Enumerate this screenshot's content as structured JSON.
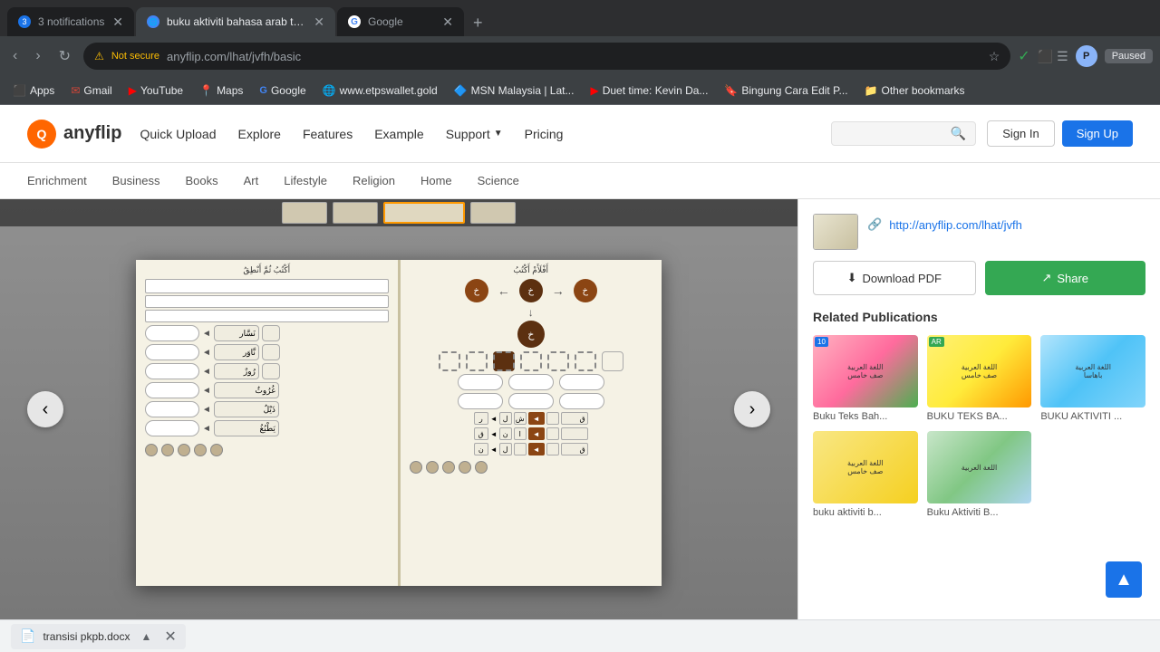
{
  "browser": {
    "tabs": [
      {
        "id": "t1",
        "label": "3 notifications",
        "favicon_type": "notification",
        "active": false
      },
      {
        "id": "t2",
        "label": "buku aktiviti bahasa arab tahun ...",
        "favicon_type": "globe",
        "active": true
      },
      {
        "id": "t3",
        "label": "Google",
        "favicon_type": "google",
        "active": false
      }
    ],
    "address": "anyflip.com/lhat/jvfh/basic",
    "security": "Not secure",
    "profile": "P",
    "paused_label": "Paused"
  },
  "bookmarks": [
    {
      "label": "Apps"
    },
    {
      "label": "Gmail"
    },
    {
      "label": "YouTube"
    },
    {
      "label": "Maps"
    },
    {
      "label": "Google"
    },
    {
      "label": "www.etpswallet.gold"
    },
    {
      "label": "MSN Malaysia | Lat..."
    },
    {
      "label": "Duet time: Kevin Da..."
    },
    {
      "label": "Bingung Cara Edit P..."
    },
    {
      "label": "Other bookmarks"
    }
  ],
  "header": {
    "logo_initial": "Q",
    "logo_name": "anyflip",
    "quick_upload": "Quick Upload",
    "explore": "Explore",
    "features": "Features",
    "example": "Example",
    "support": "Support",
    "pricing": "Pricing",
    "search_placeholder": "",
    "signin": "Sign In",
    "signup": "Sign Up"
  },
  "categories": [
    "Enrichment",
    "Business",
    "Books",
    "Art",
    "Lifestyle",
    "Religion",
    "Home",
    "Science"
  ],
  "sidebar": {
    "pub_url": "http://anyflip.com/lhat/jvfh",
    "download_label": "Download PDF",
    "share_label": "Share",
    "related_title": "Related Publications",
    "related_items": [
      {
        "label": "Buku Teks Bah...",
        "thumb_class": "related-thumb-1"
      },
      {
        "label": "BUKU TEKS BA...",
        "thumb_class": "related-thumb-2"
      },
      {
        "label": "BUKU AKTIVITI ...",
        "thumb_class": "related-thumb-3"
      },
      {
        "label": "buku aktiviti b...",
        "thumb_class": "related-thumb-4"
      },
      {
        "label": "Buku Aktiviti B...",
        "thumb_class": "related-thumb-5"
      }
    ]
  },
  "bottom_bar": {
    "filename": "transisi pkpb.docx"
  }
}
